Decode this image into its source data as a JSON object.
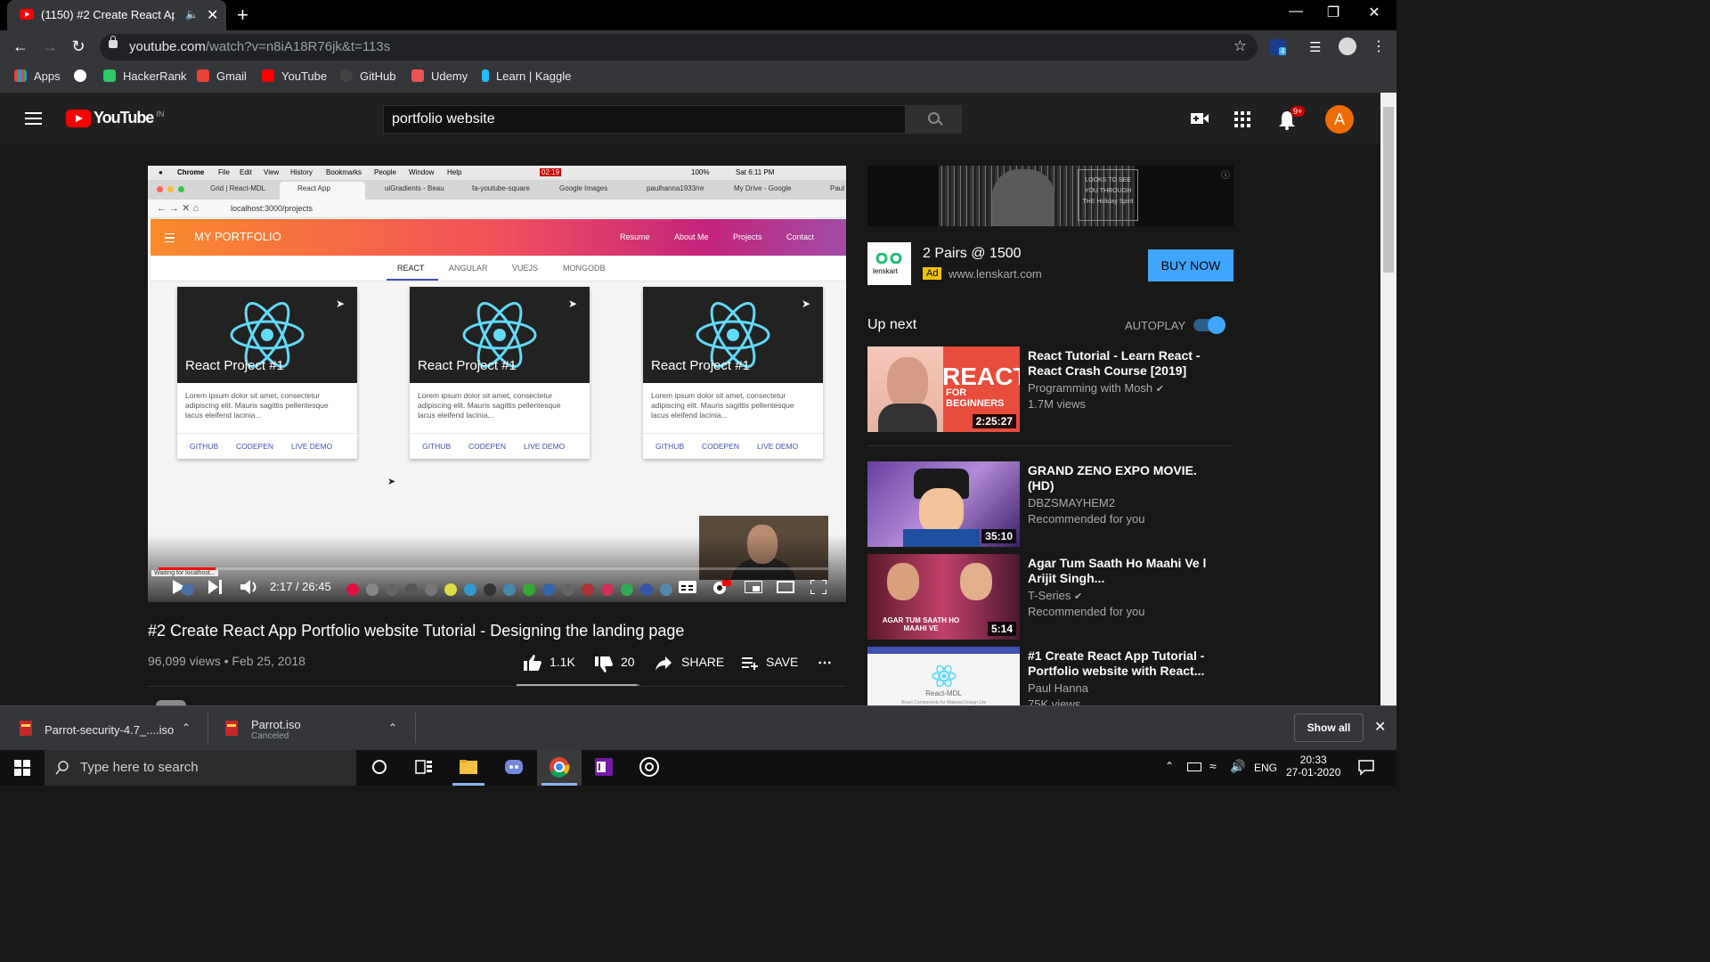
{
  "browser": {
    "tab_title": "(1150) #2 Create React App P",
    "new_tab": "+",
    "url_host": "youtube.com",
    "url_path": "/watch?v=n8iA18R76jk&t=113s",
    "bookmarks": [
      "Apps",
      "HackerRank",
      "Gmail",
      "YouTube",
      "GitHub",
      "Udemy",
      "Learn | Kaggle"
    ],
    "extension_badge": "4"
  },
  "youtube": {
    "logo_text": "YouTube",
    "region": "IN",
    "search_query": "portfolio website",
    "notifications": "9+",
    "avatar_letter": "A"
  },
  "video": {
    "time": "2:17 / 26:45",
    "progress": 0.085,
    "title": "#2 Create React App Portfolio website Tutorial - Designing the landing page",
    "meta": "96,099 views • Feb 25, 2018",
    "likes": "1.1K",
    "dislikes": "20",
    "share": "SHARE",
    "save": "SAVE",
    "like_ratio": 0.98,
    "status_hint": "Waiting for localhost..."
  },
  "inner_screen": {
    "mac_menu": [
      "Chrome",
      "File",
      "Edit",
      "View",
      "History",
      "Bookmarks",
      "People",
      "Window",
      "Help"
    ],
    "mac_clock": "Sat 6:11 PM",
    "mac_battery": "100%",
    "mac_rec": "02:19",
    "tabs": [
      "Grid | React-MDL",
      "React App",
      "uiGradients - Beau",
      "fa-youtube-square",
      "Google Images",
      "paulhanna1933/re",
      "My Drive - Google"
    ],
    "profile": "Paul",
    "url": "localhost:3000/projects",
    "portfolio_brand": "MY PORTFOLIO",
    "nav": [
      "Resume",
      "About Me",
      "Projects",
      "Contact"
    ],
    "project_tabs": [
      "REACT",
      "ANGULAR",
      "VUEJS",
      "MONGODB"
    ],
    "card_title": "React Project #1",
    "card_desc": "Lorem ipsum dolor sit amet, consectetur adipiscing elit. Mauris sagittis pellentesque lacus eleifend lacinia...",
    "card_actions": [
      "GITHUB",
      "CODEPEN",
      "LIVE DEMO"
    ]
  },
  "ad": {
    "banner_text": "LOOKS TO SEE YOU THROUGH THE Holiday Spirit",
    "logo_text": "lenskart",
    "title": "2 Pairs @ 1500",
    "tag": "Ad",
    "domain": "www.lenskart.com",
    "cta": "BUY NOW"
  },
  "upnext": {
    "heading": "Up next",
    "autoplay_label": "AUTOPLAY",
    "autoplay_on": true,
    "videos": [
      {
        "title": "React Tutorial - Learn React - React Crash Course [2019]",
        "channel": "Programming with Mosh",
        "views": "1.7M views",
        "duration": "2:25:27",
        "thumb_text": "REACT",
        "thumb_sub": "FOR BEGINNERS"
      },
      {
        "title": "GRAND ZENO EXPO MOVIE. (HD)",
        "channel": "DBZSMAYHEM2",
        "views": "Recommended for you",
        "duration": "35:10"
      },
      {
        "title": "Agar Tum Saath Ho Maahi Ve l Arijit Singh...",
        "channel": "T-Series",
        "views": "Recommended for you",
        "duration": "5:14",
        "thumb_text": "AGAR TUM SAATH HO MAAHI VE"
      },
      {
        "title": "#1 Create React App Tutorial - Portfolio website with React...",
        "channel": "Paul Hanna",
        "views": "75K views",
        "thumb_text": "React-MDL",
        "thumb_sub": "React Components for Material Design Lite"
      }
    ]
  },
  "downloads": {
    "items": [
      {
        "name": "Parrot-security-4.7_....iso",
        "status": ""
      },
      {
        "name": "Parrot.iso",
        "status": "Canceled"
      }
    ],
    "show_all": "Show all"
  },
  "taskbar": {
    "search_placeholder": "Type here to search",
    "lang": "ENG",
    "time": "20:33",
    "date": "27-01-2020"
  }
}
